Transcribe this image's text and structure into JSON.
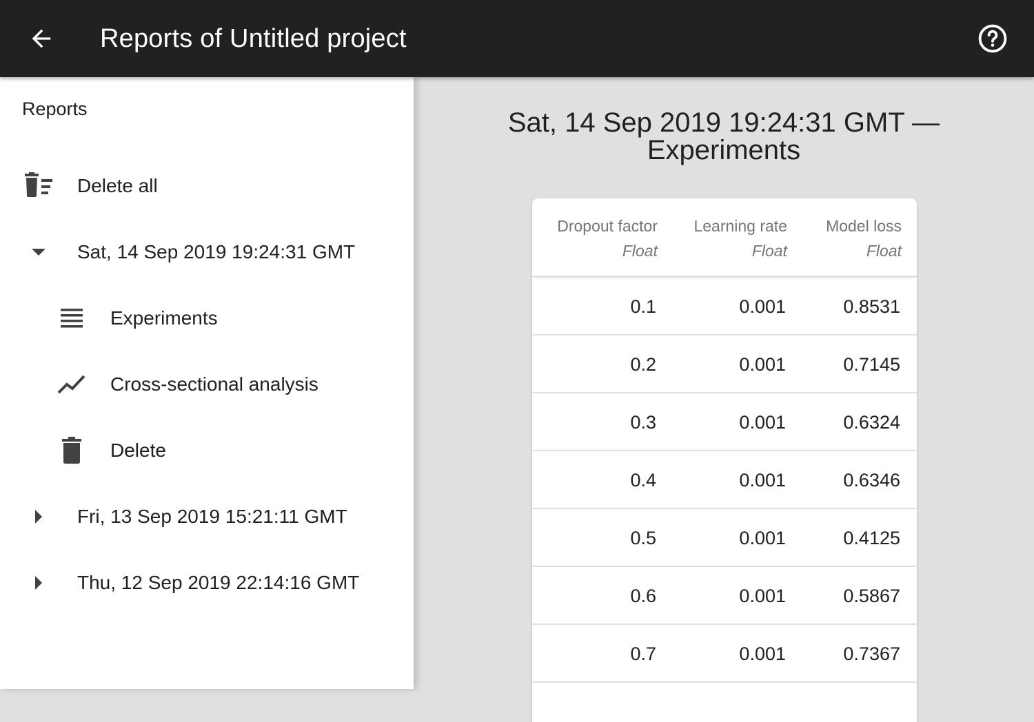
{
  "app_bar": {
    "title": "Reports of Untitled project",
    "back_icon": "arrow-back-icon",
    "help_icon": "help-circle-icon"
  },
  "drawer": {
    "subheader": "Reports",
    "delete_all": "Delete all",
    "reports": [
      {
        "label": "Sat, 14 Sep 2019 19:24:31 GMT",
        "expanded": true,
        "children": [
          {
            "label": "Experiments",
            "icon": "list-icon"
          },
          {
            "label": "Cross-sectional analysis",
            "icon": "line-chart-icon"
          },
          {
            "label": "Delete",
            "icon": "trash-icon"
          }
        ]
      },
      {
        "label": "Fri, 13 Sep 2019 15:21:11 GMT",
        "expanded": false
      },
      {
        "label": "Thu, 12 Sep 2019 22:14:16 GMT",
        "expanded": false
      }
    ]
  },
  "main": {
    "title_line1": "Sat, 14 Sep 2019 19:24:31 GMT —",
    "title_line2": "Experiments",
    "table": {
      "columns": [
        {
          "name": "Dropout factor",
          "type": "Float"
        },
        {
          "name": "Learning rate",
          "type": "Float"
        },
        {
          "name": "Model loss",
          "type": "Float"
        }
      ],
      "rows": [
        [
          "0.1",
          "0.001",
          "0.8531"
        ],
        [
          "0.2",
          "0.001",
          "0.7145"
        ],
        [
          "0.3",
          "0.001",
          "0.6324"
        ],
        [
          "0.4",
          "0.001",
          "0.6346"
        ],
        [
          "0.5",
          "0.001",
          "0.4125"
        ],
        [
          "0.6",
          "0.001",
          "0.5867"
        ],
        [
          "0.7",
          "0.001",
          "0.7367"
        ]
      ]
    }
  },
  "colors": {
    "app_bar": "#212121",
    "drawer": "#ffffff",
    "main_background": "#e0e0e0",
    "text_primary": "#212121",
    "text_secondary": "#757575"
  }
}
